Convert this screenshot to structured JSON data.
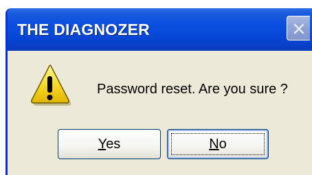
{
  "window": {
    "title": "THE DIAGNOZER",
    "close_icon": "close-icon"
  },
  "message": {
    "icon": "warning-icon",
    "text": "Password reset. Are you sure ?"
  },
  "buttons": {
    "yes": {
      "mnemonic": "Y",
      "rest": "es"
    },
    "no": {
      "mnemonic": "N",
      "rest": "o"
    }
  },
  "colors": {
    "titlebar_blue": "#0747d8",
    "dialog_bg": "#ece9d8",
    "warning_yellow": "#f5d21a"
  }
}
